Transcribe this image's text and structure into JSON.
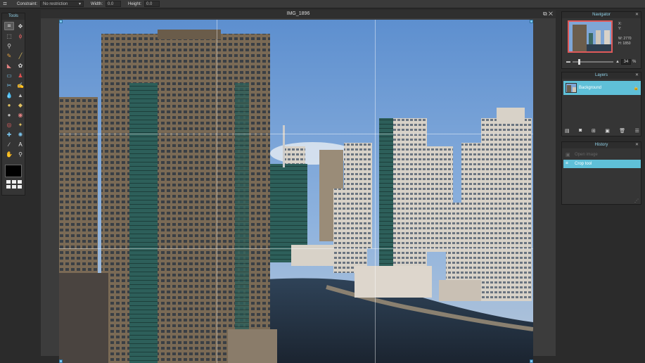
{
  "toolbar": {
    "constraint_label": "Constraint:",
    "constraint_value": "No restriction",
    "width_label": "Width:",
    "width_value": "0.0",
    "height_label": "Height:",
    "height_value": "0.0"
  },
  "tools": {
    "title": "Tools",
    "icons": [
      "crop",
      "move",
      "marquee",
      "lasso",
      "wand",
      "pencil",
      "brush",
      "eraser",
      "bucket",
      "gradient",
      "clone",
      "color-replace",
      "drawing",
      "blur",
      "sharpen",
      "smudge",
      "sponge",
      "dodge",
      "burn",
      "red-eye",
      "spot-heal",
      "bloat",
      "pinch",
      "colorpicker",
      "type",
      "hand",
      "zoom"
    ]
  },
  "document": {
    "title": "IMG_1896"
  },
  "navigator": {
    "title": "Navigator",
    "x_label": "X:",
    "y_label": "Y:",
    "w_label": "W:",
    "w_value": "2770",
    "h_label": "H:",
    "h_value": "1850",
    "zoom": "34",
    "zoom_unit": "%"
  },
  "layers": {
    "title": "Layers",
    "items": [
      {
        "name": "Background"
      }
    ]
  },
  "history": {
    "title": "History",
    "items": [
      {
        "label": "Open image",
        "active": false
      },
      {
        "label": "Crop tool",
        "active": true
      }
    ]
  },
  "colors": {
    "accent": "#5fc0d8",
    "panel_bg": "#353535",
    "app_bg": "#2b2b2b"
  }
}
